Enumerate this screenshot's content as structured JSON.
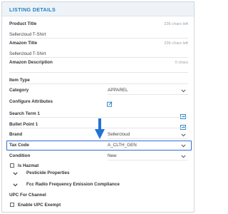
{
  "panel": {
    "title": "LISTING DETAILS"
  },
  "product_title": {
    "label": "Product Title",
    "counter": "236 chars left",
    "value": "Sellercloud T-Shirt"
  },
  "amazon_title": {
    "label": "Amazon Title",
    "counter": "236 chars left",
    "value": "Sellercloud T-Shirt"
  },
  "amazon_description": {
    "label": "Amazon Description",
    "counter": "0 chars"
  },
  "item_type": {
    "label": "Item Type"
  },
  "category": {
    "label": "Category",
    "value": "APPAREL"
  },
  "configure_attributes": {
    "label": "Configure Attributes"
  },
  "search_term": {
    "label": "Search Term 1"
  },
  "bullet_point": {
    "label": "Bullet Point 1"
  },
  "brand": {
    "label": "Brand",
    "value": "Sellercloud"
  },
  "tax_code": {
    "label": "Tax Code",
    "value": "A_CLTH_GEN"
  },
  "condition": {
    "label": "Condition",
    "value": "New"
  },
  "is_hazmat": {
    "label": "Is Hazmat",
    "checked": false
  },
  "pesticide": {
    "label": "Pesticide Properties"
  },
  "fcc": {
    "label": "Fcc Radio Frequency Emission Compliance"
  },
  "upc_for_channel": {
    "label": "UPC For Channel"
  },
  "enable_upc_exempt": {
    "label": "Enable UPC Exempt",
    "checked": false
  },
  "colors": {
    "accent": "#1f7fbf",
    "highlight": "#2f6fd6",
    "arrow": "#1f73d6"
  },
  "icons": [
    "edit-icon",
    "expand-icon",
    "chevron-down-icon",
    "arrow-down-icon"
  ]
}
